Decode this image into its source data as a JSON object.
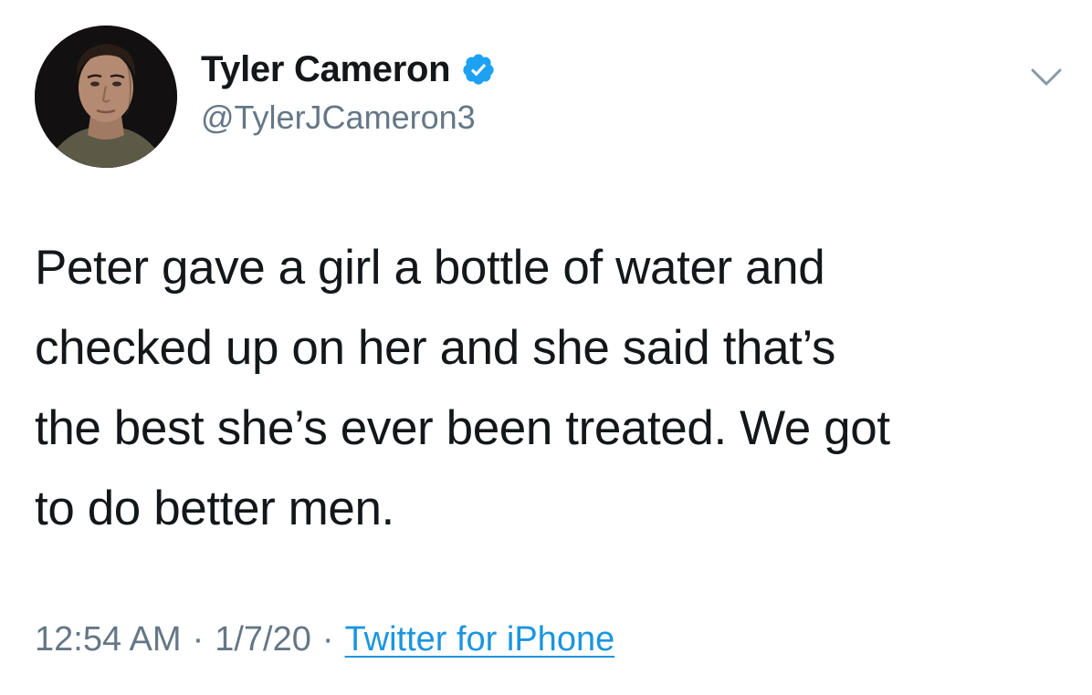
{
  "tweet": {
    "author": {
      "display_name": "Tyler Cameron",
      "handle": "@TylerJCameron3",
      "verified": true,
      "avatar_icon": "profile-photo"
    },
    "menu_icon": "chevron-down-icon",
    "text_lines": [
      "Peter gave a girl a bottle of water and",
      "checked up on her and she said that’s",
      "the best she’s ever been treated. We got",
      "to do better men."
    ],
    "meta": {
      "time": "12:54 AM",
      "separator": "·",
      "date": "1/7/20",
      "source": "Twitter for iPhone"
    }
  },
  "colors": {
    "text": "#14171a",
    "secondary": "#657786",
    "link": "#1b95e0",
    "verified_badge": "#1da1f2"
  }
}
